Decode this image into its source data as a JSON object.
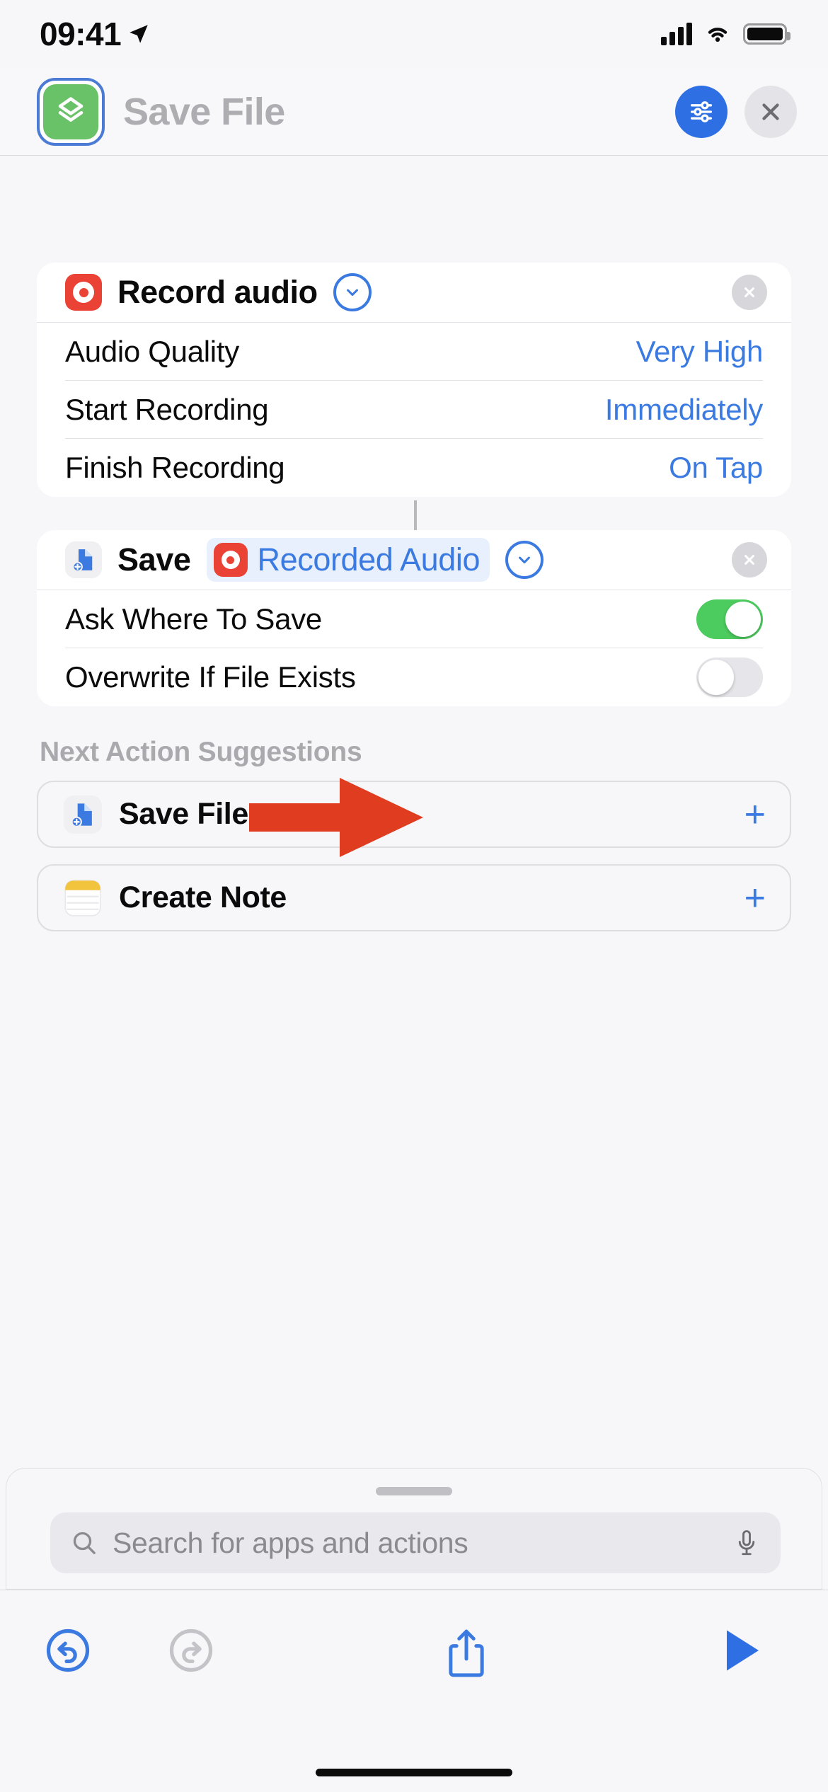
{
  "status_bar": {
    "time": "09:41",
    "location_icon": "location-arrow-icon",
    "cellular_icon": "cellular-bars-icon",
    "wifi_icon": "wifi-icon",
    "battery_icon": "battery-full-icon"
  },
  "nav": {
    "shortcut_icon": "shortcuts-stack-icon",
    "title": "Save File",
    "settings_icon": "sliders-icon",
    "close_icon": "close-x-icon"
  },
  "actions": [
    {
      "icon": "voice-memos-record-icon",
      "title": "Record audio",
      "expand_icon": "chevron-down-circle-icon",
      "remove_icon": "remove-x-icon",
      "params": [
        {
          "label": "Audio Quality",
          "value": "Very High",
          "type": "value"
        },
        {
          "label": "Start Recording",
          "value": "Immediately",
          "type": "value"
        },
        {
          "label": "Finish Recording",
          "value": "On Tap",
          "type": "value"
        }
      ]
    },
    {
      "icon": "save-file-icon",
      "title": "Save",
      "token": {
        "icon": "voice-memos-record-icon",
        "label": "Recorded Audio"
      },
      "expand_icon": "chevron-down-circle-icon",
      "remove_icon": "remove-x-icon",
      "params": [
        {
          "label": "Ask Where To Save",
          "value": "on",
          "type": "toggle"
        },
        {
          "label": "Overwrite If File Exists",
          "value": "off",
          "type": "toggle"
        }
      ]
    }
  ],
  "suggestions": {
    "title": "Next Action Suggestions",
    "items": [
      {
        "icon": "save-file-icon",
        "label": "Save File",
        "add_icon": "plus-icon"
      },
      {
        "icon": "notes-app-icon",
        "label": "Create Note",
        "add_icon": "plus-icon"
      }
    ]
  },
  "search": {
    "search_icon": "search-icon",
    "placeholder": "Search for apps and actions",
    "mic_icon": "microphone-icon",
    "grabber": "sheet-grabber"
  },
  "toolbar": {
    "undo_icon": "undo-icon",
    "redo_icon": "redo-icon",
    "share_icon": "share-icon",
    "run_icon": "play-icon"
  },
  "annotation": {
    "arrow_icon": "red-pointer-arrow",
    "color": "#e03c1f",
    "points_to": "Ask Where To Save toggle"
  },
  "colors": {
    "accent_blue": "#3b7ae0",
    "toggle_on_green": "#4ccb5f",
    "record_red": "#ea4335",
    "shortcut_green": "#69c267",
    "page_background": "#f2f2f7",
    "card_background": "#ffffff"
  }
}
